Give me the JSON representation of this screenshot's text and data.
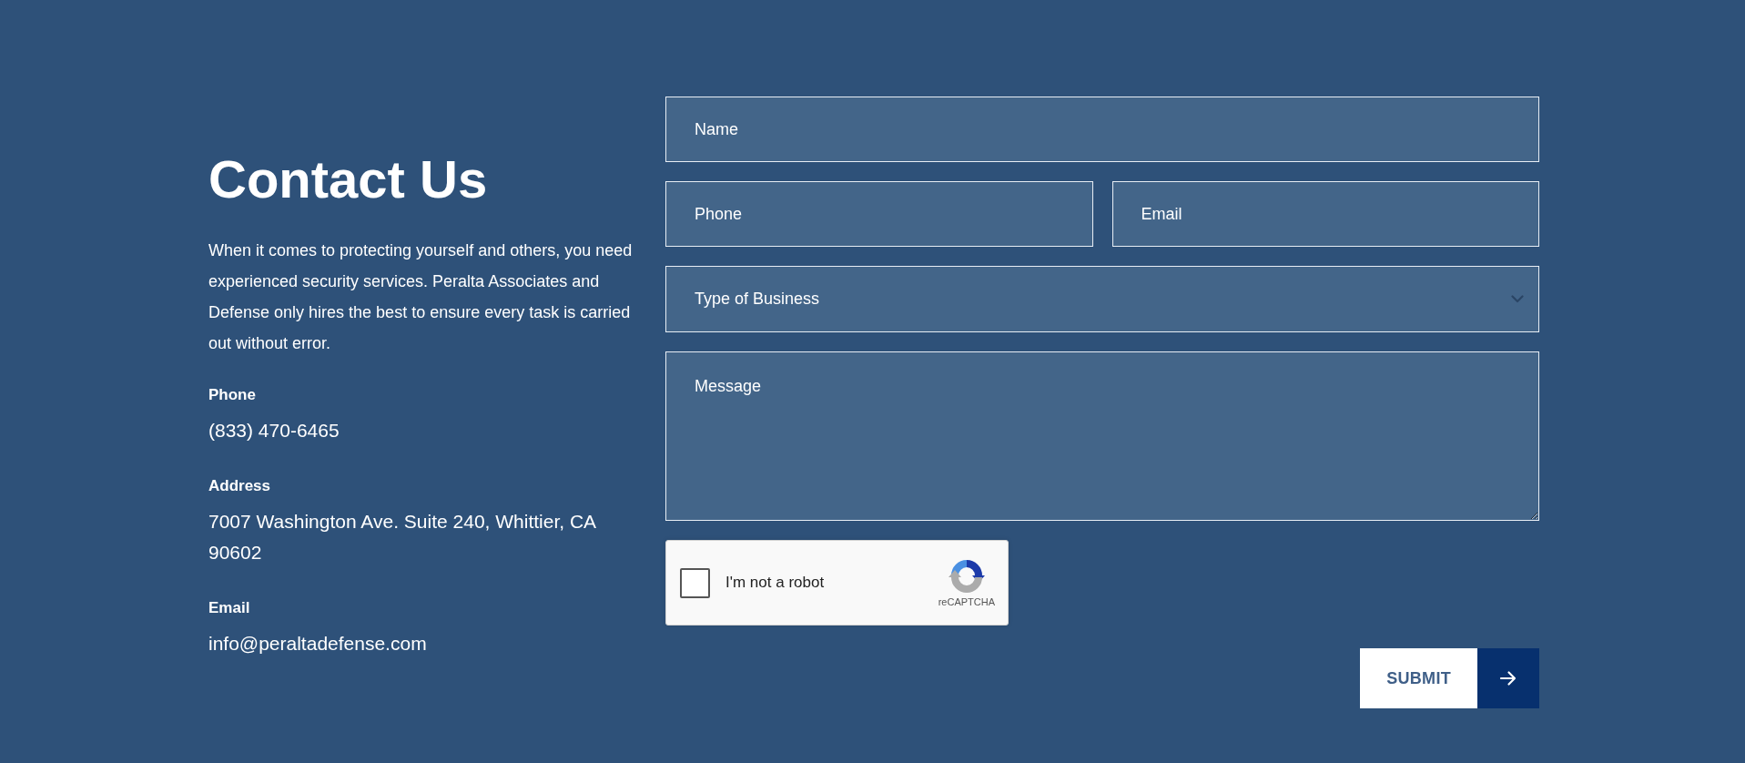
{
  "contact": {
    "heading": "Contact Us",
    "intro": "When it comes to protecting yourself and others, you need experienced security services. Peralta Associates and Defense only hires the best to ensure every task is carried out without error.",
    "details": [
      {
        "label": "Phone",
        "value": "(833) 470-6465"
      },
      {
        "label": "Address",
        "value": "7007 Washington Ave. Suite 240, Whittier, CA 90602"
      },
      {
        "label": "Email",
        "value": "info@peraltadefense.com"
      }
    ]
  },
  "form": {
    "rows": [
      [
        {
          "kind": "text",
          "placeholder": "Name"
        }
      ],
      [
        {
          "kind": "text",
          "placeholder": "Phone"
        },
        {
          "kind": "text",
          "placeholder": "Email"
        }
      ],
      [
        {
          "kind": "select",
          "value": "Type of Business"
        }
      ],
      [
        {
          "kind": "textarea",
          "placeholder": "Message"
        }
      ]
    ],
    "captcha": {
      "label": "I'm not a robot",
      "checked": false,
      "brand": "reCAPTCHA"
    },
    "submit": {
      "label": "SUBMIT"
    }
  }
}
